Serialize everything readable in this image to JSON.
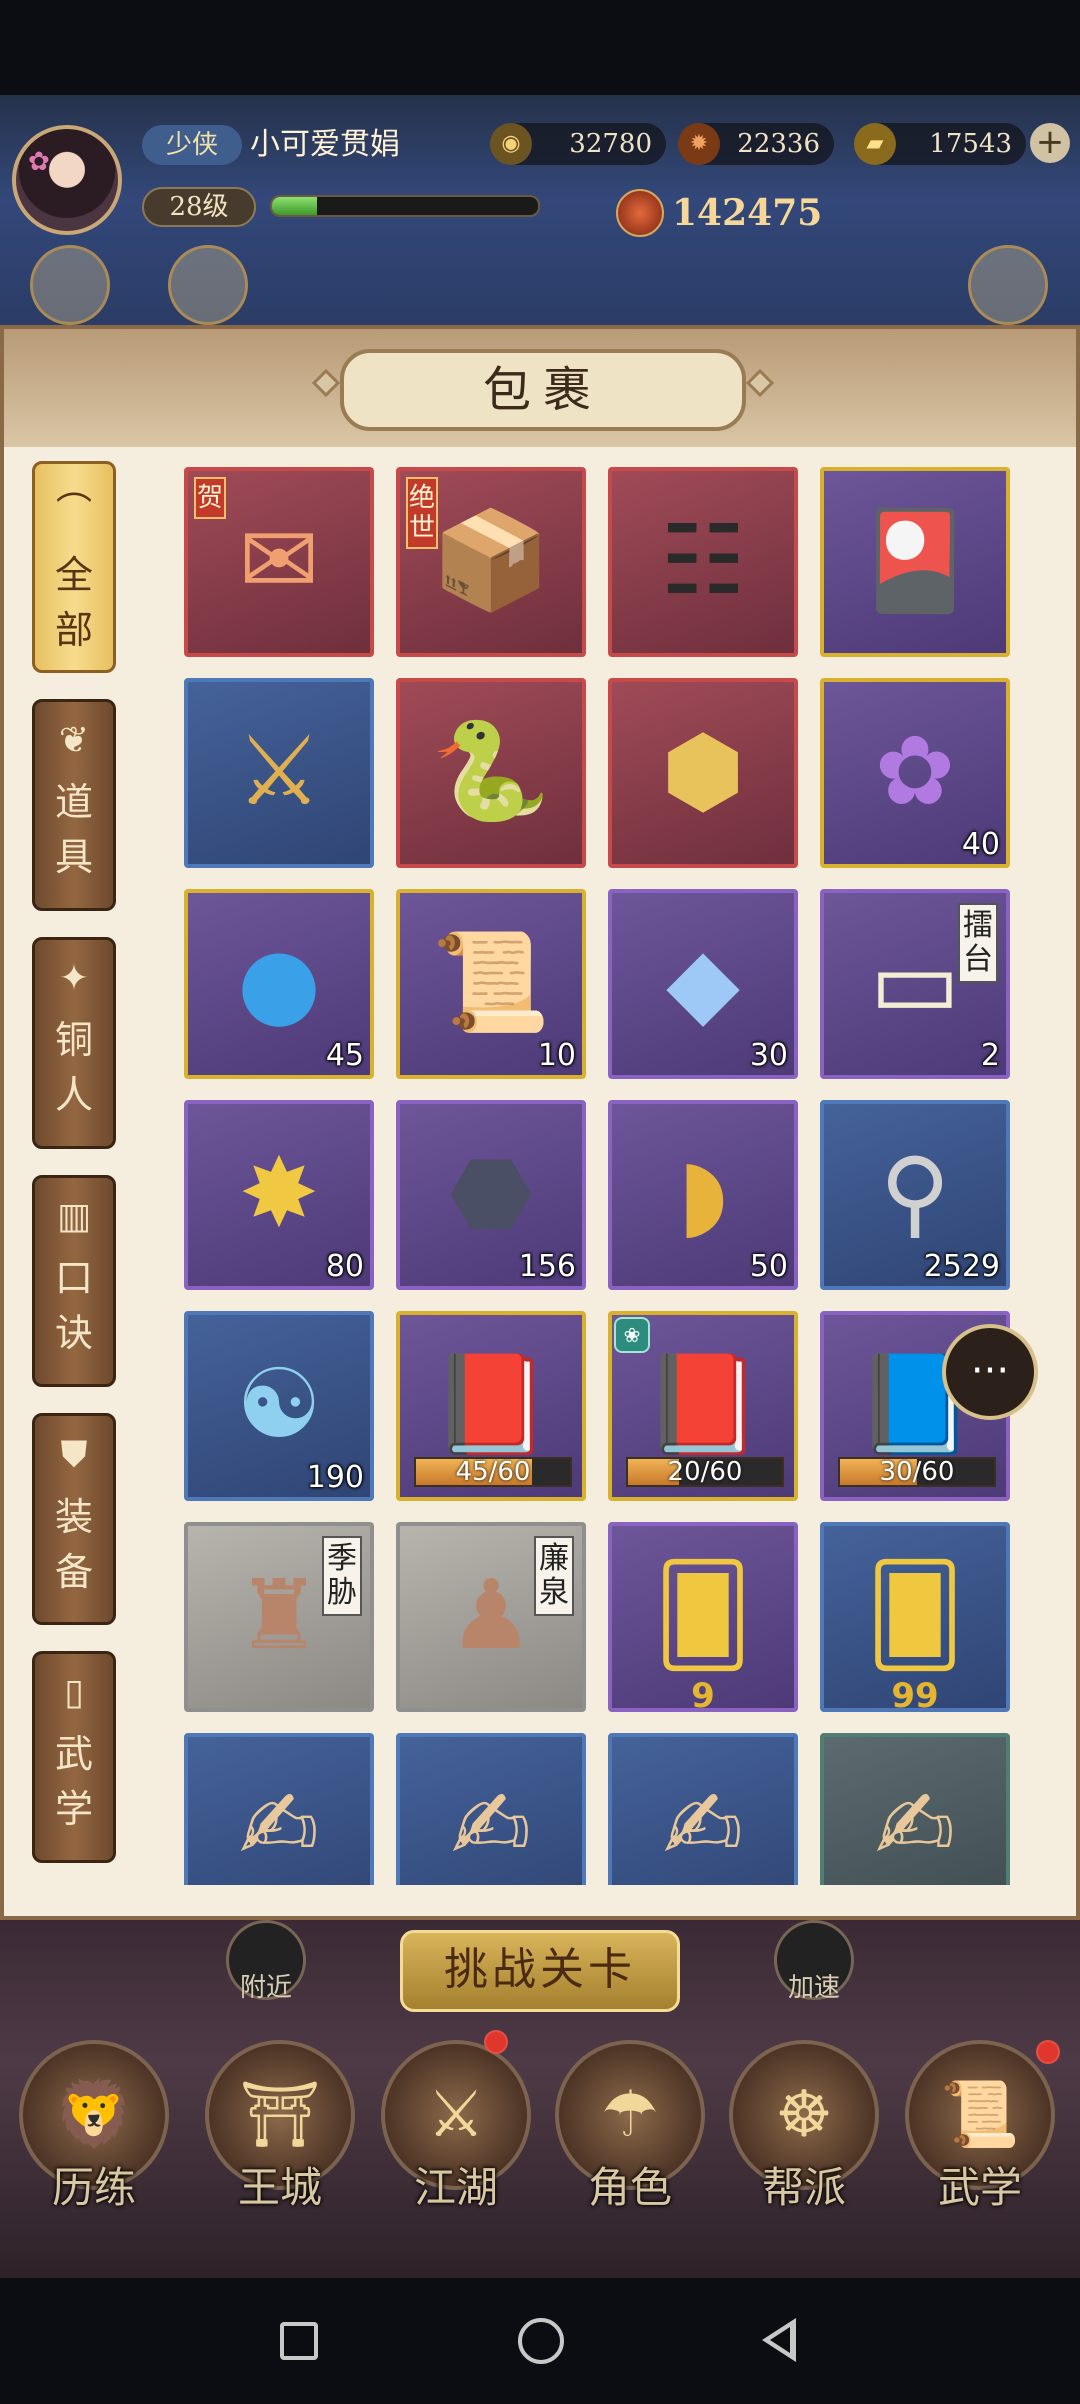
{
  "header": {
    "rank": "少侠",
    "player_name": "小可爱贯娟",
    "level": "28级",
    "exp_fraction": 0.17,
    "currency_1": "32780",
    "currency_2": "22336",
    "currency_3": "17543",
    "combat_power": "142475"
  },
  "panel": {
    "title": "包裹"
  },
  "tabs": [
    {
      "c1": "全",
      "c2": "部",
      "icon": "folding-fan"
    },
    {
      "c1": "道",
      "c2": "具",
      "icon": "pouch"
    },
    {
      "c1": "铜",
      "c2": "人",
      "icon": "figure"
    },
    {
      "c1": "口",
      "c2": "诀",
      "icon": "scroll-bars"
    },
    {
      "c1": "装",
      "c2": "备",
      "icon": "armor"
    },
    {
      "c1": "武",
      "c2": "学",
      "icon": "book"
    }
  ],
  "items": [
    {
      "icon": "red-envelope-gift",
      "frame": "red",
      "special_tag": "贺"
    },
    {
      "icon": "golden-book-chest",
      "frame": "red",
      "special_tag": "绝世"
    },
    {
      "icon": "silhouette-scroll",
      "frame": "red"
    },
    {
      "icon": "card-treasure-box",
      "frame": "gold"
    },
    {
      "icon": "weapon-chest",
      "frame": "blue"
    },
    {
      "icon": "red-snake",
      "frame": "red"
    },
    {
      "icon": "gold-ore",
      "frame": "red"
    },
    {
      "icon": "rainbow-petal-flower",
      "frame": "gold",
      "count": "40"
    },
    {
      "icon": "blue-spirit-orb",
      "frame": "gold",
      "count": "45"
    },
    {
      "icon": "golden-scroll",
      "frame": "gold",
      "count": "10"
    },
    {
      "icon": "blue-gem",
      "frame": "purple",
      "count": "30"
    },
    {
      "icon": "arena-token",
      "frame": "purple",
      "count": "2",
      "name_tag": "擂台"
    },
    {
      "icon": "gold-star-crystal",
      "frame": "purple",
      "count": "80"
    },
    {
      "icon": "iron-ore",
      "frame": "purple",
      "count": "156"
    },
    {
      "icon": "gold-nugget",
      "frame": "purple",
      "count": "50"
    },
    {
      "icon": "scroll-with-tassel",
      "frame": "blue",
      "count": "2529"
    },
    {
      "icon": "yin-yang-orb",
      "frame": "blue",
      "count": "190"
    },
    {
      "icon": "red-martial-manual",
      "frame": "gold",
      "progress": "45/60",
      "progress_value": 0.75
    },
    {
      "icon": "red-martial-manual",
      "frame": "gold",
      "progress": "20/60",
      "progress_value": 0.33,
      "corner_badge": "lotus"
    },
    {
      "icon": "purple-martial-manual",
      "frame": "purple",
      "progress": "30/60",
      "progress_value": 0.5
    },
    {
      "icon": "bronze-figure-squat",
      "frame": "grey",
      "name_tag": "季胁"
    },
    {
      "icon": "bronze-figure-stand",
      "frame": "grey",
      "name_tag": "廉泉"
    },
    {
      "icon": "gold-martial-card",
      "frame": "purple",
      "under_num": "9"
    },
    {
      "icon": "gold-martial-card",
      "frame": "blue",
      "under_num": "99"
    },
    {
      "icon": "martial-parchment",
      "frame": "blue"
    },
    {
      "icon": "martial-parchment",
      "frame": "blue"
    },
    {
      "icon": "martial-parchment",
      "frame": "blue"
    },
    {
      "icon": "martial-parchment",
      "frame": "green"
    }
  ],
  "bottom": {
    "challenge_label": "挑战关卡",
    "nearby_label": "附近",
    "speed_label": "加速",
    "nav": [
      {
        "label": "历练",
        "icon": "lion-mask"
      },
      {
        "label": "王城",
        "icon": "palace-gate"
      },
      {
        "label": "江湖",
        "icon": "sword-pin"
      },
      {
        "label": "角色",
        "icon": "straw-hat-hero"
      },
      {
        "label": "帮派",
        "icon": "clan-seal"
      },
      {
        "label": "武学",
        "icon": "scroll-stack"
      }
    ]
  },
  "colors": {
    "panel_bg": "#f5eddd",
    "tab_active": "#f7dc8d",
    "frame_red": "#c64a49",
    "frame_gold": "#d8b22e",
    "frame_blue": "#4f78b8",
    "frame_purple": "#8a62c2"
  }
}
